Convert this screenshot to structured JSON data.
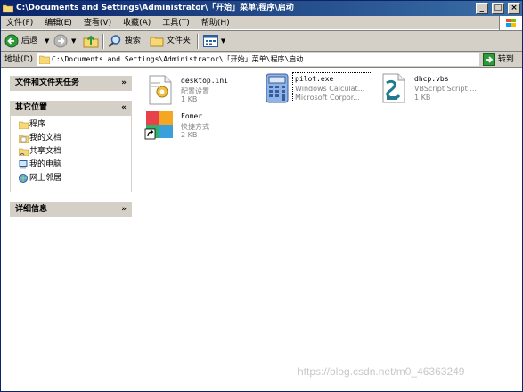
{
  "window": {
    "title": "C:\\Documents and Settings\\Administrator\\「开始」菜单\\程序\\启动",
    "controls": {
      "minimize": "_",
      "maximize": "□",
      "close": "×"
    }
  },
  "menu": [
    "文件(F)",
    "编辑(E)",
    "查看(V)",
    "收藏(A)",
    "工具(T)",
    "帮助(H)"
  ],
  "toolbar": {
    "back": "后退",
    "search": "搜索",
    "folders": "文件夹"
  },
  "address": {
    "label": "地址(D)",
    "value": "C:\\Documents and Settings\\Administrator\\「开始」菜单\\程序\\启动",
    "go": "转到"
  },
  "taskpane": {
    "tasks_title": "文件和文件夹任务",
    "places_title": "其它位置",
    "places": [
      "程序",
      "我的文档",
      "共享文档",
      "我的电脑",
      "网上邻居"
    ],
    "details_title": "详细信息"
  },
  "files": [
    {
      "name": "desktop.ini",
      "line1": "配置设置",
      "line2": "1 KB"
    },
    {
      "name": "pilot.exe",
      "line1": "Windows Calculat...",
      "line2": "Microsoft Corpor..."
    },
    {
      "name": "dhcp.vbs",
      "line1": "VBScript Script ...",
      "line2": "1 KB"
    },
    {
      "name": "Fomer",
      "line1": "快捷方式",
      "line2": "2 KB"
    }
  ],
  "watermark": "https://blog.csdn.net/m0_46363249"
}
